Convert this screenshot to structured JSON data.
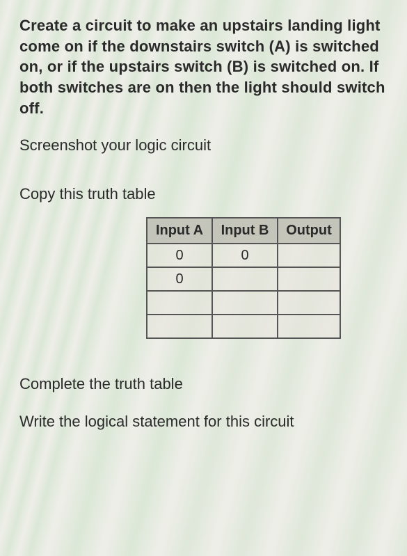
{
  "paragraphs": {
    "intro": "Create a circuit to make an upstairs landing light come on if the downstairs switch (A) is switched on, or if the upstairs switch (B) is switched on. If both switches are on then the light should switch off.",
    "screenshot": "Screenshot your logic circuit",
    "copy": "Copy this truth table",
    "complete": "Complete the truth table",
    "write": "Write the logical statement for this circuit"
  },
  "table": {
    "headers": [
      "Input A",
      "Input B",
      "Output"
    ],
    "rows": [
      [
        "0",
        "0",
        ""
      ],
      [
        "0",
        "",
        ""
      ],
      [
        "",
        "",
        ""
      ],
      [
        "",
        "",
        ""
      ]
    ]
  }
}
